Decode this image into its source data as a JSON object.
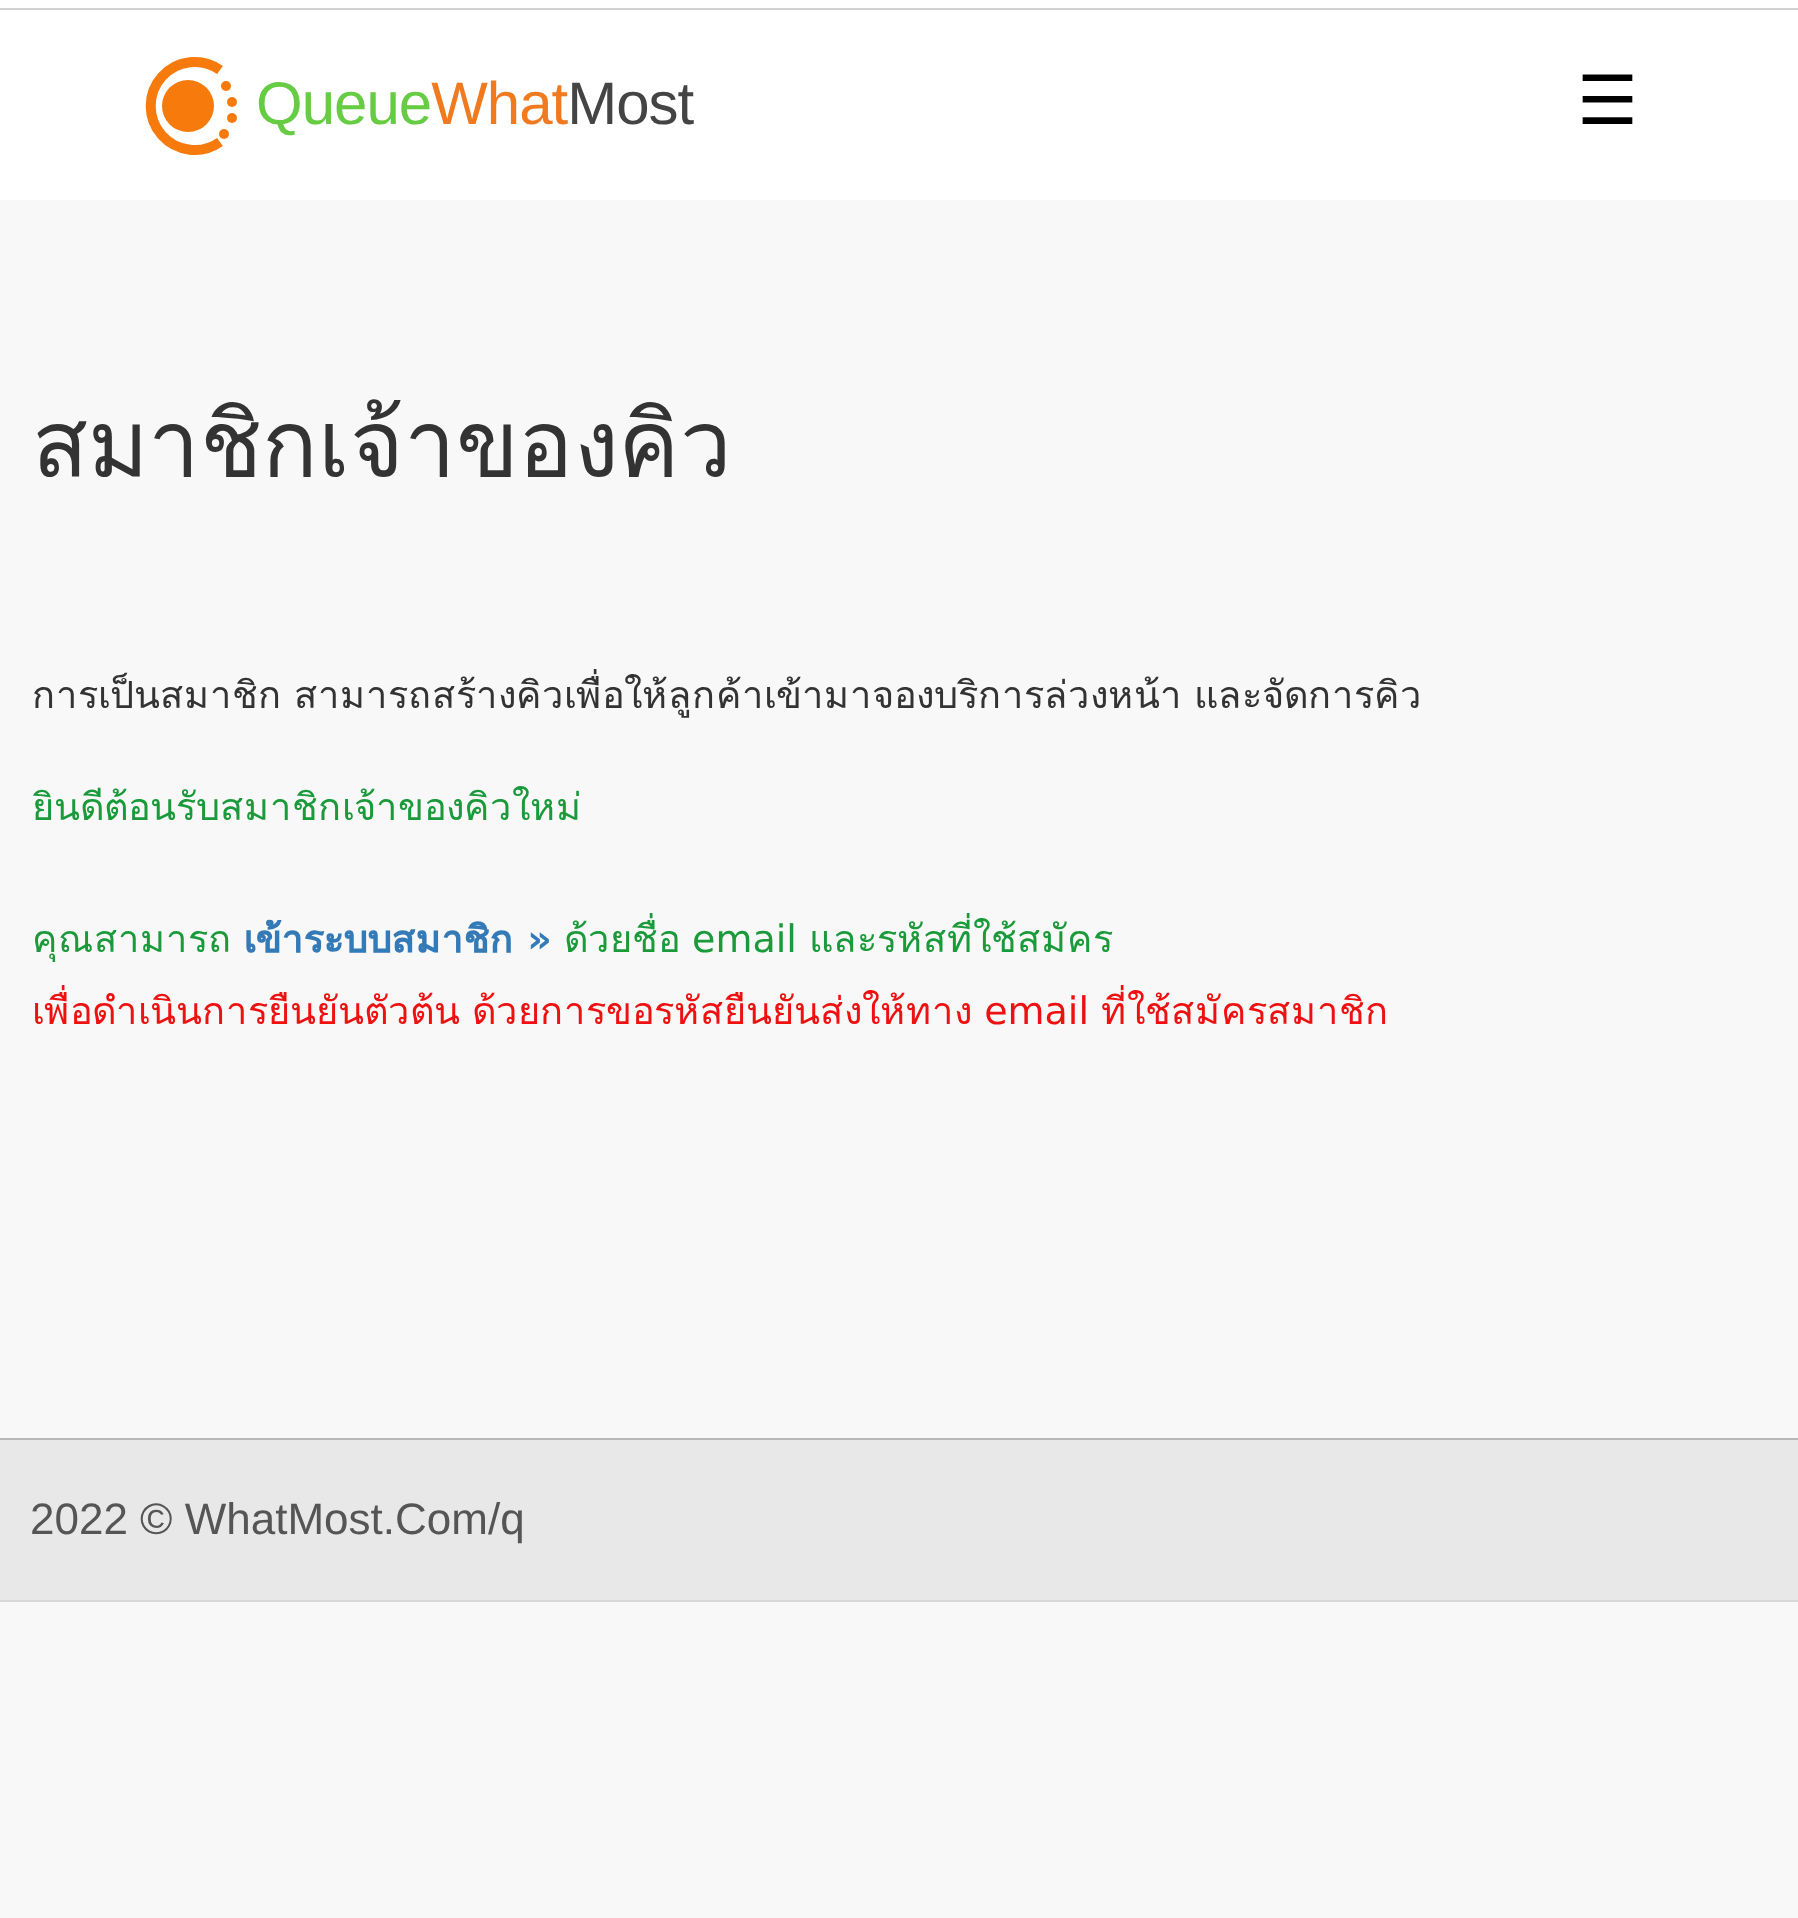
{
  "logo": {
    "parts": [
      {
        "text": "Queue",
        "color": "#66cc44"
      },
      {
        "text": "What",
        "color": "#f07a20"
      },
      {
        "text": "Most",
        "color": "#444444"
      }
    ]
  },
  "menu_button": {
    "label": "☰"
  },
  "title": "สมาชิกเจ้าของคิว",
  "intro": "การเป็นสมาชิก สามารถสร้างคิวเพื่อให้ลูกค้าเข้ามาจองบริการล่วงหน้า และจัดการคิว",
  "welcome": "ยินดีต้อนรับสมาชิกเจ้าของคิวใหม่",
  "login_line": {
    "before": "คุณสามารถ ",
    "link": "เข้าระบบสมาชิก »",
    "after": " ด้วยชื่อ email และรหัสที่ใช้สมัคร"
  },
  "notice": "เพื่อดำเนินการยืนยันตัวต้น ด้วยการขอรหัสยืนยันส่งให้ทาง email ที่ใช้สมัครสมาชิก",
  "footer": "2022 © WhatMost.Com/q"
}
